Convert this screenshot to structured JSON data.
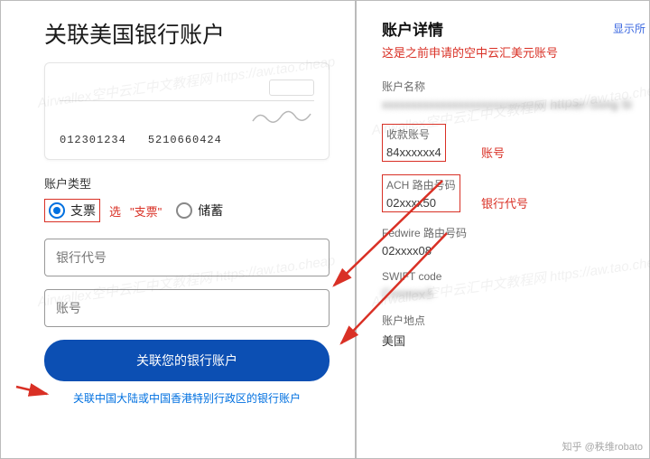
{
  "left": {
    "title": "关联美国银行账户",
    "check": {
      "routing": "012301234",
      "account": "5210660424"
    },
    "accountTypeLabel": "账户类型",
    "options": {
      "check": "支票",
      "savings": "储蓄"
    },
    "hintSelect": "选",
    "hintCheck": "\"支票\"",
    "inputBankCode": "银行代号",
    "inputAccount": "账号",
    "submitBtn": "关联您的银行账户",
    "altLink": "关联中国大陆或中国香港特别行政区的银行账户"
  },
  "right": {
    "title": "账户详情",
    "note": "这是之前申请的空中云汇美元账号",
    "showAll": "显示所",
    "fields": {
      "nameLabel": "账户名称",
      "nameValue": "xxxxxxxxxxxxxxxxxxxxxxxxxxxx xxxxan Gong Si",
      "recvLabel": "收款账号",
      "recvValue": "84xxxxxx4",
      "recvTag": "账号",
      "achLabel": "ACH 路由号码",
      "achValue": "02xxxx50",
      "achTag": "银行代号",
      "fedLabel": "Fedwire 路由号码",
      "fedValue": "02xxxx08",
      "swiftLabel": "SWIFT code",
      "swiftValue": "Cxxxxxx3",
      "locLabel": "账户地点",
      "locValue": "美国"
    }
  },
  "watermark": "Airwallex空中云汇中文教程网 https://aw.tao.cheap",
  "zhihu": "知乎 @秩维robato"
}
